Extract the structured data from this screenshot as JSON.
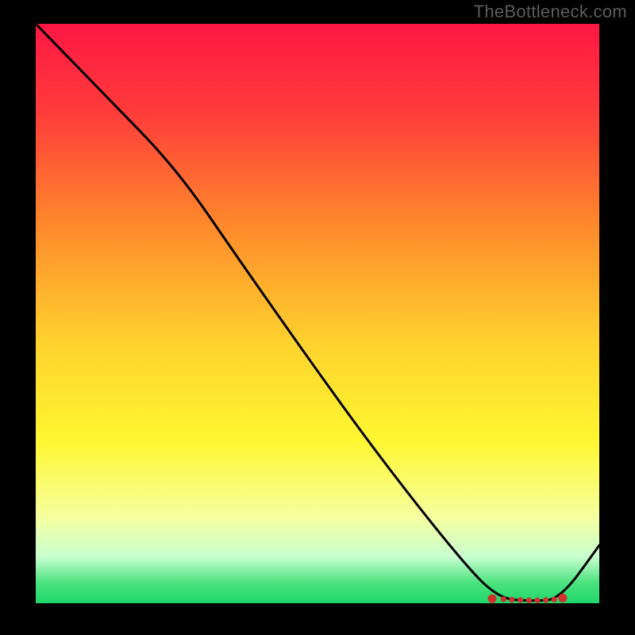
{
  "watermark": "TheBottleneck.com",
  "chart_data": {
    "type": "line",
    "title": "",
    "xlabel": "",
    "ylabel": "",
    "xlim": [
      0,
      100
    ],
    "ylim": [
      0,
      100
    ],
    "series": [
      {
        "name": "curve",
        "color": "#000000",
        "x": [
          0,
          12,
          25,
          37,
          50,
          62,
          75,
          82,
          88,
          93,
          100
        ],
        "y": [
          100,
          88,
          75,
          58,
          40,
          24,
          8,
          0.8,
          0.4,
          0.6,
          10
        ]
      }
    ],
    "markers": {
      "name": "optimal-range",
      "color": "#d2312a",
      "x": [
        81,
        83,
        84.5,
        86,
        87.5,
        89,
        90.5,
        92,
        93.5
      ],
      "y": [
        0.8,
        0.7,
        0.6,
        0.55,
        0.5,
        0.5,
        0.55,
        0.65,
        0.9
      ]
    },
    "gradient_stops": [
      {
        "offset": 0,
        "color": "#ff1744"
      },
      {
        "offset": 0.15,
        "color": "#ff3b3b"
      },
      {
        "offset": 0.35,
        "color": "#ff8a2b"
      },
      {
        "offset": 0.55,
        "color": "#ffd22e"
      },
      {
        "offset": 0.72,
        "color": "#fff731"
      },
      {
        "offset": 0.85,
        "color": "#f6ff9e"
      },
      {
        "offset": 0.92,
        "color": "#c8ffd0"
      },
      {
        "offset": 0.965,
        "color": "#4be27e"
      },
      {
        "offset": 1.0,
        "color": "#1ed76a"
      }
    ]
  }
}
